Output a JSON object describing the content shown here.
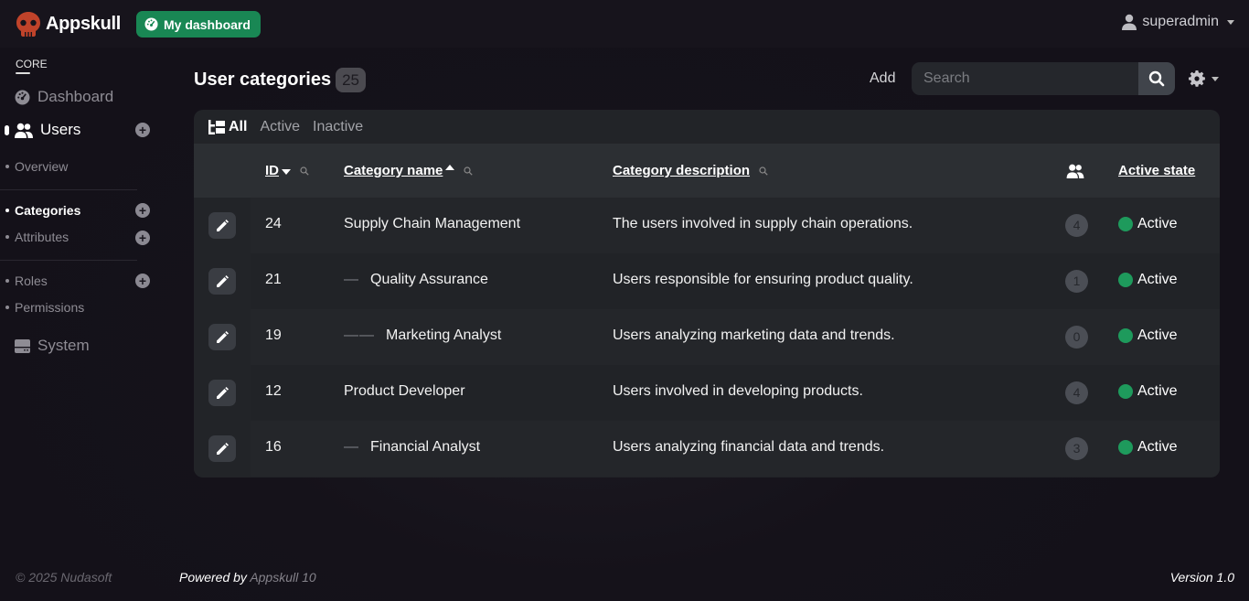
{
  "header": {
    "brand": "Appskull",
    "dashboard_button": "My dashboard",
    "user": "superadmin"
  },
  "sidebar": {
    "section_label": "CORE",
    "dashboard": "Dashboard",
    "users": "Users",
    "overview": "Overview",
    "categories": "Categories",
    "attributes": "Attributes",
    "roles": "Roles",
    "permissions": "Permissions",
    "system": "System"
  },
  "main": {
    "title": "User categories",
    "count": "25",
    "add_label": "Add",
    "search_placeholder": "Search",
    "filters": [
      "All",
      "Active",
      "Inactive"
    ],
    "columns": {
      "id": "ID",
      "name": "Category name",
      "description": "Category description",
      "state": "Active state"
    },
    "rows": [
      {
        "id": "24",
        "indent": "",
        "name": "Supply Chain Management",
        "description": "The users involved in supply chain operations.",
        "users": "4",
        "state": "Active"
      },
      {
        "id": "21",
        "indent": "—",
        "name": "Quality Assurance",
        "description": "Users responsible for ensuring product quality.",
        "users": "1",
        "state": "Active"
      },
      {
        "id": "19",
        "indent": "——",
        "name": "Marketing Analyst",
        "description": "Users analyzing marketing data and trends.",
        "users": "0",
        "state": "Active"
      },
      {
        "id": "12",
        "indent": "",
        "name": "Product Developer",
        "description": "Users involved in developing products.",
        "users": "4",
        "state": "Active"
      },
      {
        "id": "16",
        "indent": "—",
        "name": "Financial Analyst",
        "description": "Users analyzing financial data and trends.",
        "users": "3",
        "state": "Active"
      }
    ]
  },
  "footer": {
    "copyright": "© 2025 Nudasoft",
    "powered_by": "Powered by",
    "powered_app": "Appskull 10",
    "version": "Version 1.0"
  },
  "colors": {
    "accent_green": "#198754",
    "brand_red": "#c0432a",
    "active_dot": "#1e9a5c"
  }
}
